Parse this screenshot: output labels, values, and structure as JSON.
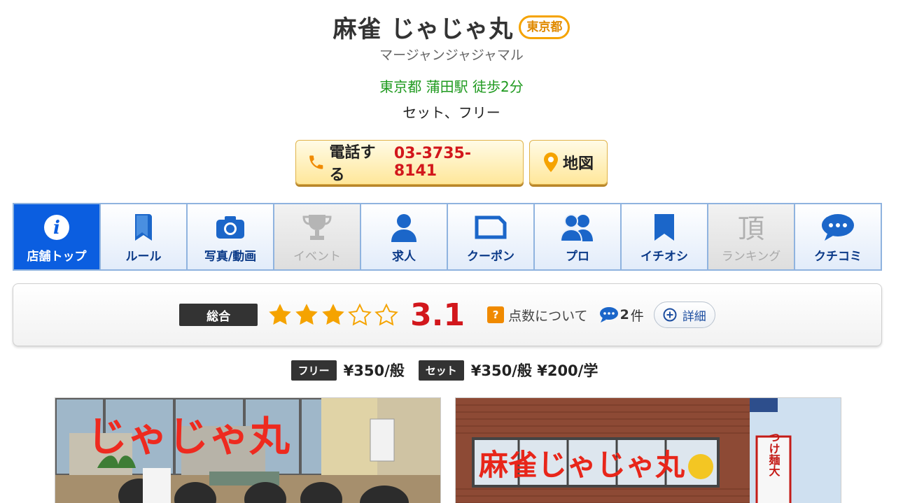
{
  "shop": {
    "title": "麻雀 じゃじゃ丸",
    "prefecture_badge": "東京都",
    "kana": "マージャンジャジャマル",
    "access": "東京都 蒲田駅 徒歩2分",
    "types": "セット、フリー"
  },
  "buttons": {
    "phone_label": "電話する",
    "phone_number": "03-3735-8141",
    "map_label": "地図"
  },
  "tabs": [
    {
      "label": "店舗トップ",
      "icon": "info-icon",
      "state": "active"
    },
    {
      "label": "ルール",
      "icon": "book-icon",
      "state": "normal"
    },
    {
      "label": "写真/動画",
      "icon": "camera-icon",
      "state": "normal"
    },
    {
      "label": "イベント",
      "icon": "trophy-icon",
      "state": "disabled"
    },
    {
      "label": "求人",
      "icon": "person-icon",
      "state": "normal"
    },
    {
      "label": "クーポン",
      "icon": "coupon-icon",
      "state": "normal"
    },
    {
      "label": "プロ",
      "icon": "people-icon",
      "state": "normal"
    },
    {
      "label": "イチオシ",
      "icon": "bookmark-icon",
      "state": "normal"
    },
    {
      "label": "ランキング",
      "icon": "kanji-top-icon",
      "state": "disabled"
    },
    {
      "label": "クチコミ",
      "icon": "chat-bubble-icon",
      "state": "normal"
    }
  ],
  "rating": {
    "label": "総合",
    "stars_filled": 3,
    "stars_total": 5,
    "score": "3.1",
    "about_label": "点数について",
    "question_mark": "?",
    "review_count": "2",
    "review_unit": "件",
    "detail_label": "詳細"
  },
  "prices": {
    "free_tag": "フリー",
    "free_value": "¥350/般",
    "set_tag": "セット",
    "set_value": "¥350/般 ¥200/学"
  },
  "photos": {
    "photo1_sign": "じゃじゃ丸",
    "photo2_sign": "麻雀じゃじゃ丸",
    "photo2_side_sign": "つけ麺大"
  },
  "colors": {
    "accent_blue": "#0b5ee0",
    "score_red": "#d2171c",
    "access_green": "#1f9a1f",
    "badge_orange": "#f5a300"
  }
}
